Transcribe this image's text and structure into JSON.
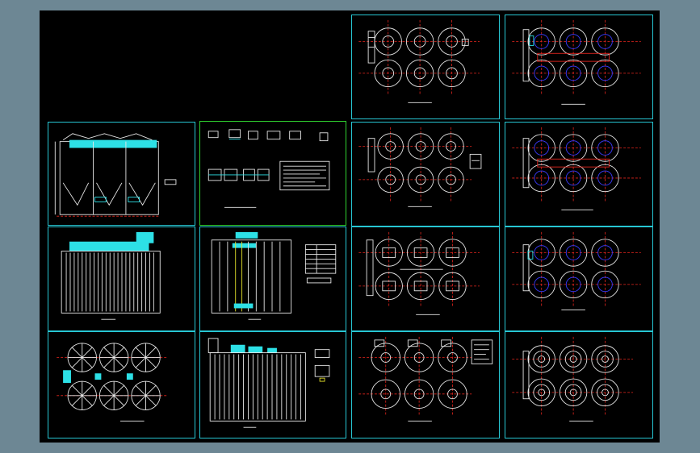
{
  "viewport": {
    "background_color": "#6d8794",
    "canvas_color": "#000000",
    "frame_color": "#27c6d3",
    "selected_frame_color": "#2fd12f"
  },
  "drawing_sheets": [
    {
      "id": "blank-area",
      "kind": "empty"
    },
    {
      "id": "sheet-tank-plan-1",
      "kind": "tank-plan",
      "style": "white"
    },
    {
      "id": "sheet-tank-plan-2",
      "kind": "tank-plan",
      "style": "white-blue"
    },
    {
      "id": "sheet-hopper-section",
      "kind": "hopper-section"
    },
    {
      "id": "sheet-details",
      "kind": "details",
      "selected": true
    },
    {
      "id": "sheet-tank-plan-3",
      "kind": "tank-plan",
      "style": "white"
    },
    {
      "id": "sheet-tank-plan-4",
      "kind": "tank-plan",
      "style": "white-blue"
    },
    {
      "id": "sheet-bag-elevation-1",
      "kind": "bag-elevation"
    },
    {
      "id": "sheet-bag-section-table",
      "kind": "bag-section-table"
    },
    {
      "id": "sheet-tank-plan-5",
      "kind": "tank-plan",
      "style": "dense"
    },
    {
      "id": "sheet-tank-plan-6",
      "kind": "tank-plan",
      "style": "white-blue"
    },
    {
      "id": "sheet-spoke-plan",
      "kind": "spoke-plan"
    },
    {
      "id": "sheet-bag-elevation-2",
      "kind": "bag-elevation-annotated"
    },
    {
      "id": "sheet-tank-plan-7",
      "kind": "tank-plan",
      "style": "dense"
    },
    {
      "id": "sheet-tank-plan-8",
      "kind": "tank-plan",
      "style": "plain"
    }
  ]
}
